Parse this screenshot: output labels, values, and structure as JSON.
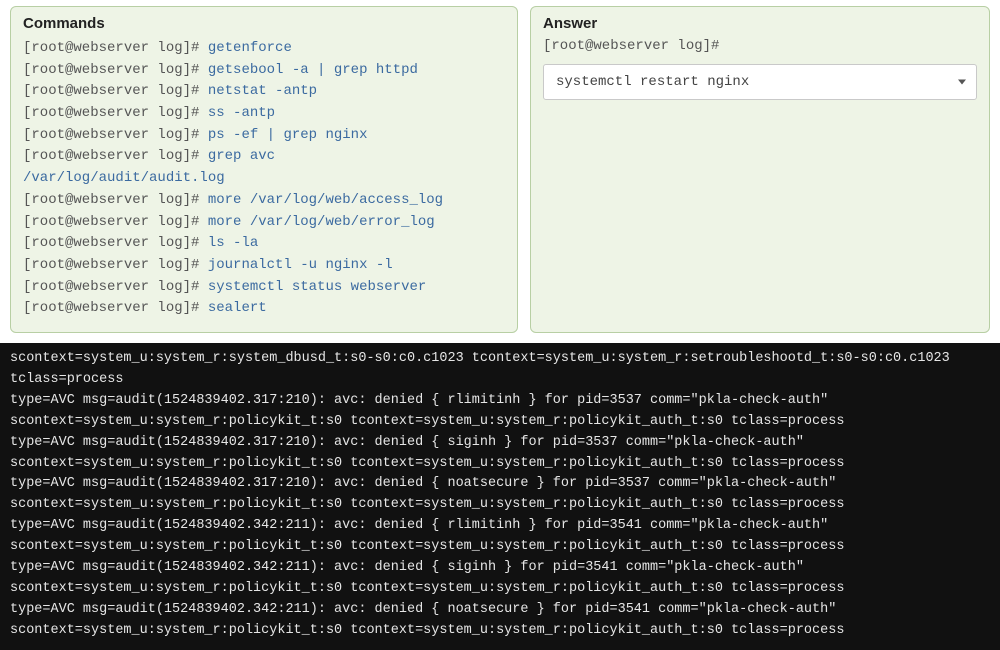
{
  "commands": {
    "title": "Commands",
    "prompt": "[root@webserver log]#",
    "lines": [
      {
        "prompt": true,
        "cmd": "getenforce"
      },
      {
        "prompt": true,
        "cmd": "getsebool -a | grep httpd"
      },
      {
        "prompt": true,
        "cmd": "netstat -antp"
      },
      {
        "prompt": true,
        "cmd": "ss -antp"
      },
      {
        "prompt": true,
        "cmd": "ps -ef | grep nginx"
      },
      {
        "prompt": true,
        "cmd": "grep avc"
      },
      {
        "prompt": false,
        "cmd": "/var/log/audit/audit.log"
      },
      {
        "prompt": true,
        "cmd": "more /var/log/web/access_log"
      },
      {
        "prompt": true,
        "cmd": "more /var/log/web/error_log"
      },
      {
        "prompt": true,
        "cmd": "ls -la"
      },
      {
        "prompt": true,
        "cmd": "journalctl -u nginx -l"
      },
      {
        "prompt": true,
        "cmd": "systemctl status webserver"
      },
      {
        "prompt": true,
        "cmd": "sealert"
      }
    ]
  },
  "answer": {
    "title": "Answer",
    "prompt": "[root@webserver log]#",
    "selected": "systemctl restart nginx"
  },
  "terminal": {
    "lines": [
      "scontext=system_u:system_r:system_dbusd_t:s0-s0:c0.c1023 tcontext=system_u:system_r:setroubleshootd_t:s0-s0:c0.c1023 tclass=process",
      "type=AVC msg=audit(1524839402.317:210): avc: denied { rlimitinh } for pid=3537 comm=\"pkla-check-auth\"",
      "scontext=system_u:system_r:policykit_t:s0 tcontext=system_u:system_r:policykit_auth_t:s0 tclass=process",
      "type=AVC msg=audit(1524839402.317:210): avc: denied { siginh } for pid=3537 comm=\"pkla-check-auth\"",
      "scontext=system_u:system_r:policykit_t:s0 tcontext=system_u:system_r:policykit_auth_t:s0 tclass=process",
      "type=AVC msg=audit(1524839402.317:210): avc: denied { noatsecure } for pid=3537 comm=\"pkla-check-auth\"",
      "scontext=system_u:system_r:policykit_t:s0 tcontext=system_u:system_r:policykit_auth_t:s0 tclass=process",
      "type=AVC msg=audit(1524839402.342:211): avc: denied { rlimitinh } for pid=3541 comm=\"pkla-check-auth\"",
      "scontext=system_u:system_r:policykit_t:s0 tcontext=system_u:system_r:policykit_auth_t:s0 tclass=process",
      "type=AVC msg=audit(1524839402.342:211): avc: denied { siginh } for pid=3541 comm=\"pkla-check-auth\"",
      "scontext=system_u:system_r:policykit_t:s0 tcontext=system_u:system_r:policykit_auth_t:s0 tclass=process",
      "type=AVC msg=audit(1524839402.342:211): avc: denied { noatsecure } for pid=3541 comm=\"pkla-check-auth\"",
      "scontext=system_u:system_r:policykit_t:s0 tcontext=system_u:system_r:policykit_auth_t:s0 tclass=process"
    ]
  }
}
